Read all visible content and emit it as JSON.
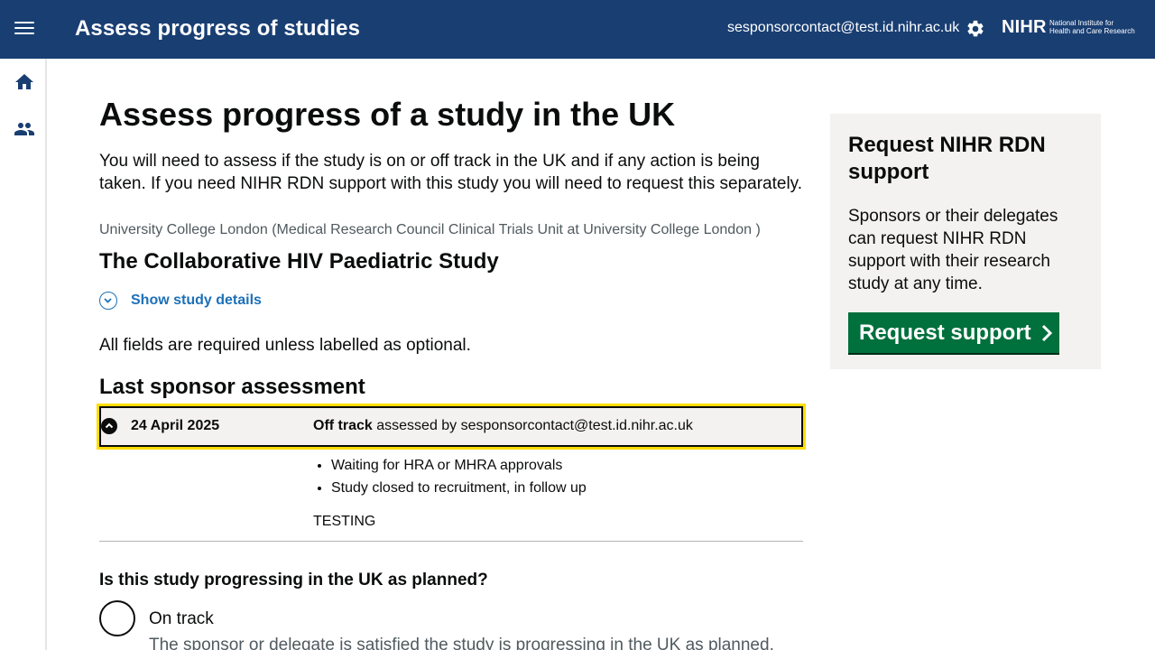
{
  "header": {
    "title": "Assess progress of studies",
    "user_email": "sesponsorcontact@test.id.nihr.ac.uk",
    "logo": {
      "main": "NIHR",
      "sub_line1": "National Institute for",
      "sub_line2": "Health and Care Research"
    }
  },
  "sidebar": {
    "items": [
      {
        "icon": "home-icon"
      },
      {
        "icon": "people-icon"
      }
    ]
  },
  "main": {
    "page_title": "Assess progress of a study in the UK",
    "intro": "You will need to assess if the study is on or off track in the UK and if any action is being taken. If you need NIHR RDN support with this study you will need to request this separately.",
    "organisation": "University College London (Medical Research Council Clinical Trials Unit at University College London )",
    "study_title": "The Collaborative HIV Paediatric Study",
    "show_details_label": "Show study details",
    "required_note": "All fields are required unless labelled as optional.",
    "last_assessment": {
      "heading": "Last sponsor assessment",
      "date": "24 April 2025",
      "status": "Off track",
      "assessed_by_text": " assessed by sesponsorcontact@test.id.nihr.ac.uk",
      "reasons": [
        "Waiting for HRA or MHRA approvals",
        "Study closed to recruitment, in follow up"
      ],
      "comment": "TESTING"
    },
    "question": {
      "label": "Is this study progressing in the UK as planned?",
      "options": [
        {
          "label": "On track",
          "hint": "The sponsor or delegate is satisfied the study is progressing in the UK as planned."
        }
      ]
    }
  },
  "aside": {
    "heading": "Request NIHR RDN support",
    "text": "Sponsors or their delegates can request NIHR RDN support with their research study at any time.",
    "button_label": "Request support"
  },
  "colors": {
    "header_bg": "#193e72",
    "link": "#1d70b8",
    "button": "#00703c",
    "focus": "#ffdd00",
    "panel_bg": "#f3f2f1"
  }
}
